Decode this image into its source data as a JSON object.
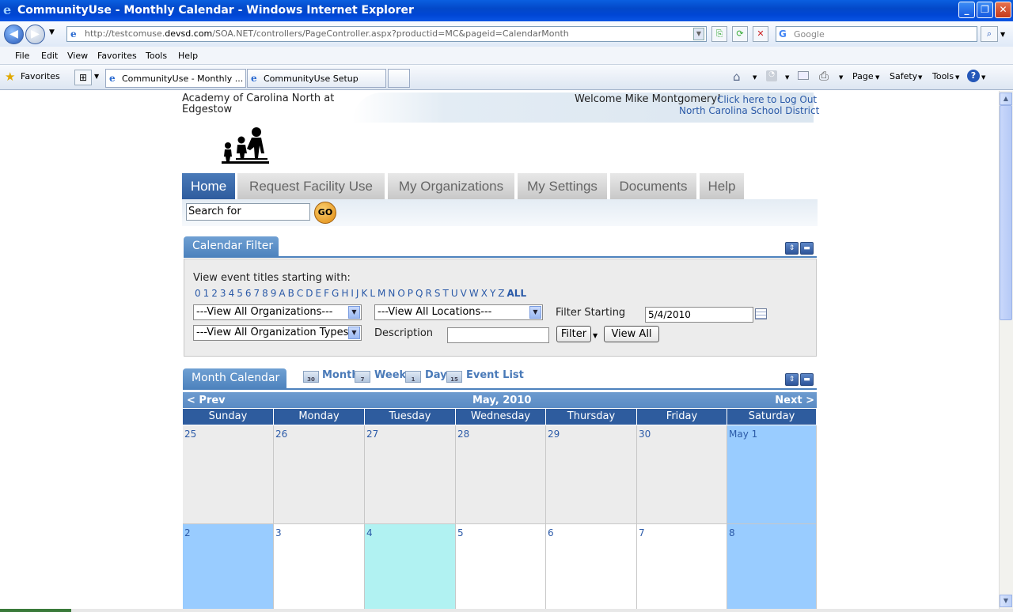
{
  "window": {
    "title": "CommunityUse - Monthly Calendar - Windows Internet Explorer",
    "minimize": "_",
    "restore": "❐",
    "close": "✕"
  },
  "browser": {
    "url_prefix": "http://testcomuse.",
    "url_domain": "devsd.com",
    "url_rest": "/SOA.NET/controllers/PageController.aspx?productid=MC&pageid=CalendarMonth",
    "search_placeholder": "Google",
    "menu": [
      "File",
      "Edit",
      "View",
      "Favorites",
      "Tools",
      "Help"
    ],
    "favorites_label": "Favorites",
    "tabs": [
      {
        "label": "CommunityUse - Monthly ..."
      },
      {
        "label": "CommunityUse Setup"
      }
    ],
    "commands": {
      "page": "Page",
      "safety": "Safety",
      "tools": "Tools"
    }
  },
  "header": {
    "school": "Academy of Carolina North at Edgestow",
    "welcome": "Welcome Mike Montgomery!",
    "logout": "Click here to Log Out",
    "district": "North Carolina School District"
  },
  "nav_tabs": [
    "Home",
    "Request Facility Use",
    "My Organizations",
    "My Settings",
    "Documents",
    "Help"
  ],
  "search": {
    "value": "Search for",
    "go": "GO"
  },
  "filter": {
    "title": "Calendar Filter",
    "prompt": "View event titles starting with:",
    "letters": [
      "0",
      "1",
      "2",
      "3",
      "4",
      "5",
      "6",
      "7",
      "8",
      "9",
      "A",
      "B",
      "C",
      "D",
      "E",
      "F",
      "G",
      "H",
      "I",
      "J",
      "K",
      "L",
      "M",
      "N",
      "O",
      "P",
      "Q",
      "R",
      "S",
      "T",
      "U",
      "V",
      "W",
      "X",
      "Y",
      "Z"
    ],
    "all": "ALL",
    "organizations": "---View All Organizations---",
    "locations": "---View All Locations---",
    "org_types": "---View All Organization Types---",
    "filter_starting_label": "Filter Starting",
    "filter_starting_value": "5/4/2010",
    "description_label": "Description",
    "description_value": "",
    "filter_button": "Filter",
    "view_all_button": "View All"
  },
  "calendar": {
    "title": "Month Calendar",
    "views": [
      "Month",
      "Week",
      "Day",
      "Event List"
    ],
    "view_icons": [
      "30",
      "7",
      "1",
      "15"
    ],
    "prev": "< Prev",
    "next": "Next >",
    "month_label": "May, 2010",
    "day_names": [
      "Sunday",
      "Monday",
      "Tuesday",
      "Wednesday",
      "Thursday",
      "Friday",
      "Saturday"
    ],
    "weeks": [
      [
        "25",
        "26",
        "27",
        "28",
        "29",
        "30",
        "May 1"
      ],
      [
        "2",
        "3",
        "4",
        "5",
        "6",
        "7",
        "8"
      ]
    ]
  },
  "colors": {
    "tab_active": "#2e5c9e",
    "weekend": "#99ccff",
    "today": "#b1f2f2",
    "other_month": "#ececec"
  }
}
